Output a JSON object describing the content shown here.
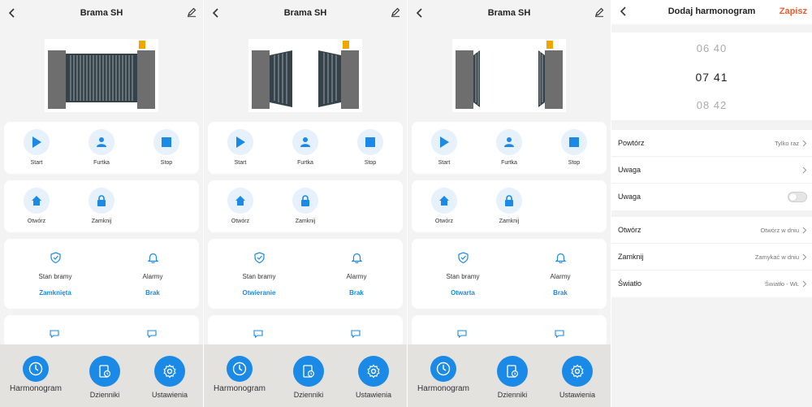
{
  "screens": [
    {
      "title": "Brama SH",
      "gate_state": "closed",
      "actions": {
        "start": "Start",
        "wicket": "Furtka",
        "stop": "Stop",
        "open": "Otwórz",
        "close": "Zamknij"
      },
      "status": {
        "gate_label": "Stan bramy",
        "gate_value": "Zamknięta",
        "alarm_label": "Alarmy",
        "alarm_value": "Brak"
      },
      "nav": {
        "schedule": "Harmonogram",
        "logs": "Dzienniki",
        "settings": "Ustawienia"
      }
    },
    {
      "title": "Brama SH",
      "gate_state": "opening",
      "actions": {
        "start": "Start",
        "wicket": "Furtka",
        "stop": "Stop",
        "open": "Otwórz",
        "close": "Zamknij"
      },
      "status": {
        "gate_label": "Stan bramy",
        "gate_value": "Otwieranie",
        "alarm_label": "Alarmy",
        "alarm_value": "Brak"
      },
      "nav": {
        "schedule": "Harmonogram",
        "logs": "Dzienniki",
        "settings": "Ustawienia"
      }
    },
    {
      "title": "Brama SH",
      "gate_state": "open",
      "actions": {
        "start": "Start",
        "wicket": "Furtka",
        "stop": "Stop",
        "open": "Otwórz",
        "close": "Zamknij"
      },
      "status": {
        "gate_label": "Stan bramy",
        "gate_value": "Otwarta",
        "alarm_label": "Alarmy",
        "alarm_value": "Brak"
      },
      "nav": {
        "schedule": "Harmonogram",
        "logs": "Dzienniki",
        "settings": "Ustawienia"
      }
    }
  ],
  "schedule": {
    "title": "Dodaj harmonogram",
    "save": "Zapisz",
    "picker": {
      "prev": "06 40",
      "selected": "07 41",
      "next": "08 42"
    },
    "rows": [
      {
        "label": "Powtórz",
        "value": "Tylko raz"
      },
      {
        "label": "Uwaga",
        "value": ""
      },
      {
        "label": "Uwaga",
        "toggle": false
      }
    ],
    "rows2": [
      {
        "label": "Otwórz",
        "value": "Otwórz w dniu"
      },
      {
        "label": "Zamknij",
        "value": "Zamykać w dniu"
      },
      {
        "label": "Światło",
        "value": "Światło - WŁ"
      }
    ]
  },
  "colors": {
    "accent": "#1a8ae6",
    "save": "#f25c2a",
    "bottom_bar": "#e4e2df"
  }
}
